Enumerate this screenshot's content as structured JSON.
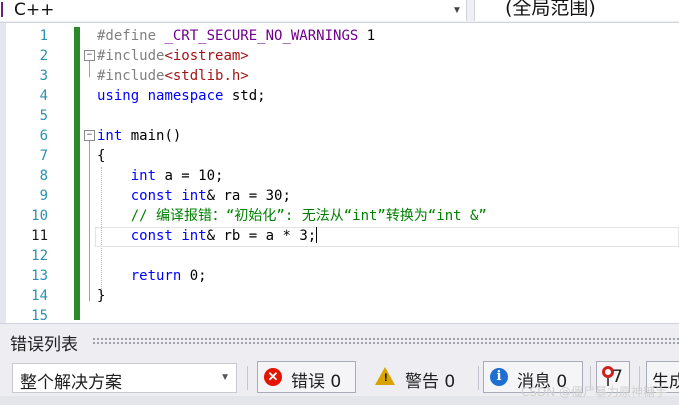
{
  "toolbar": {
    "project": "C++",
    "scope": "(全局范围)"
  },
  "editor": {
    "line_numbers": [
      "1",
      "2",
      "3",
      "4",
      "5",
      "6",
      "7",
      "8",
      "9",
      "10",
      "11",
      "12",
      "13",
      "14",
      "15"
    ],
    "current_line": "11",
    "lines": [
      [
        {
          "t": "#define ",
          "c": "pp"
        },
        {
          "t": "_CRT_SECURE_NO_WARNINGS",
          "c": "mac"
        },
        {
          "t": " 1",
          "c": "num"
        }
      ],
      [
        {
          "t": "#include",
          "c": "pp"
        },
        {
          "t": "<iostream>",
          "c": "inc"
        }
      ],
      [
        {
          "t": "#include",
          "c": "pp"
        },
        {
          "t": "<stdlib.h>",
          "c": "inc"
        }
      ],
      [
        {
          "t": "using",
          "c": "kw"
        },
        {
          "t": " ",
          "c": ""
        },
        {
          "t": "namespace",
          "c": "kw"
        },
        {
          "t": " std;",
          "c": ""
        }
      ],
      [],
      [
        {
          "t": "int",
          "c": "kw"
        },
        {
          "t": " main()",
          "c": ""
        }
      ],
      [
        {
          "t": "{",
          "c": ""
        }
      ],
      [
        {
          "t": "    ",
          "c": ""
        },
        {
          "t": "int",
          "c": "kw"
        },
        {
          "t": " a = 10;",
          "c": ""
        }
      ],
      [
        {
          "t": "    ",
          "c": ""
        },
        {
          "t": "const",
          "c": "kw"
        },
        {
          "t": " ",
          "c": ""
        },
        {
          "t": "int",
          "c": "kw"
        },
        {
          "t": "& ra = 30;",
          "c": ""
        }
      ],
      [
        {
          "t": "    // 编译报错：“初始化”: 无法从“int”转换为“int &”",
          "c": "cmt"
        }
      ],
      [
        {
          "t": "    ",
          "c": ""
        },
        {
          "t": "const",
          "c": "kw"
        },
        {
          "t": " ",
          "c": ""
        },
        {
          "t": "int",
          "c": "kw"
        },
        {
          "t": "& rb = a * 3;",
          "c": ""
        }
      ],
      [],
      [
        {
          "t": "    ",
          "c": ""
        },
        {
          "t": "return",
          "c": "kw"
        },
        {
          "t": " 0;",
          "c": ""
        }
      ],
      [
        {
          "t": "}",
          "c": ""
        }
      ],
      []
    ]
  },
  "error_list": {
    "title": "错误列表",
    "scope_select": "整个解决方案",
    "errors_label": "错误 0",
    "warnings_label": "警告 0",
    "messages_label": "消息 0",
    "filter_count": "7",
    "build_label": "生成"
  },
  "watermark": "CSDN @僵尸暴力原神糖手",
  "colors": {
    "keyword": "#0000ff",
    "preprocessor": "#808080",
    "include_path": "#a31515",
    "macro": "#6f008a",
    "comment": "#008000",
    "line_number": "#2b91af",
    "change_bar": "#2a8a2a",
    "error_icon": "#e51400",
    "warning_icon": "#d9a400",
    "info_icon": "#1e6fd0"
  }
}
